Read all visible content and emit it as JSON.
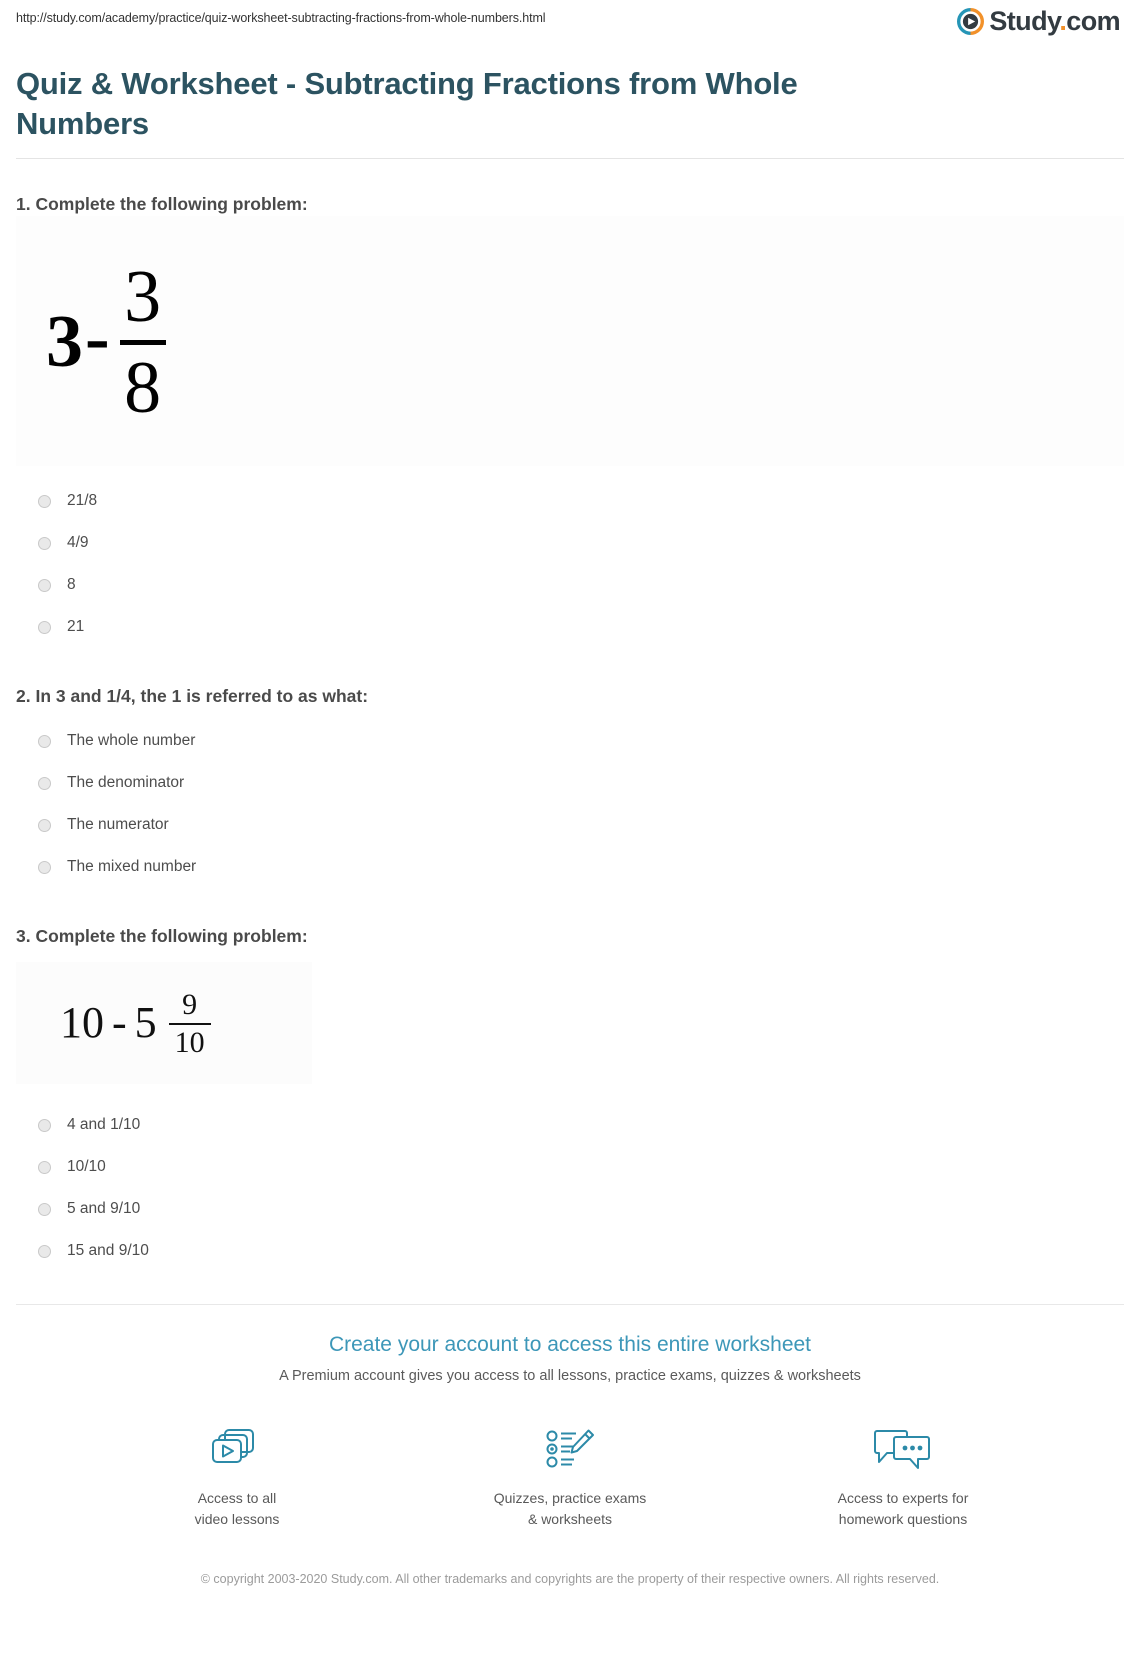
{
  "header": {
    "url": "http://study.com/academy/practice/quiz-worksheet-subtracting-fractions-from-whole-numbers.html",
    "logo": {
      "icon": "play-circle-icon",
      "word": "Study",
      "dot": ".",
      "tld": "com",
      "mark_teal": "#2595b6",
      "mark_orange": "#f2912a",
      "text_color": "#333b41"
    },
    "title": "Quiz & Worksheet - Subtracting Fractions from Whole Numbers",
    "title_color": "#2c5361"
  },
  "questions": [
    {
      "prompt": "1. Complete the following problem:",
      "math": {
        "name": "math-expression-3-minus-3-8",
        "whole": "3",
        "operator": "-",
        "numerator": "3",
        "denominator": "8",
        "plain": "3 - 3/8"
      },
      "options": [
        "21/8",
        "4/9",
        "8",
        "21"
      ]
    },
    {
      "prompt": "2. In 3 and 1/4, the 1 is referred to as what:",
      "options": [
        "The whole number",
        "The denominator",
        "The numerator",
        "The mixed number"
      ]
    },
    {
      "prompt": "3. Complete the following problem:",
      "math": {
        "name": "math-expression-10-minus-5-and-9-10",
        "whole": "10",
        "operator": "-",
        "mixed_whole": "5",
        "numerator": "9",
        "denominator": "10",
        "plain": "10 - 5 9/10"
      },
      "options": [
        "4 and 1/10",
        "10/10",
        "5 and 9/10",
        "15 and 9/10"
      ]
    }
  ],
  "promo": {
    "title": "Create your account to access this entire worksheet",
    "subtitle": "A Premium account gives you access to all lessons, practice exams, quizzes & worksheets",
    "accent_color": "#3d97b8",
    "features": [
      {
        "icon": "video-lessons-icon",
        "label": "Access to all\nvideo lessons"
      },
      {
        "icon": "quiz-pencil-icon",
        "label": "Quizzes, practice exams\n& worksheets"
      },
      {
        "icon": "chat-bubbles-icon",
        "label": "Access to experts for\nhomework questions"
      }
    ]
  },
  "footer": {
    "copyright": "© copyright 2003-2020 Study.com. All other trademarks and copyrights are the property of their respective owners. All rights reserved."
  }
}
